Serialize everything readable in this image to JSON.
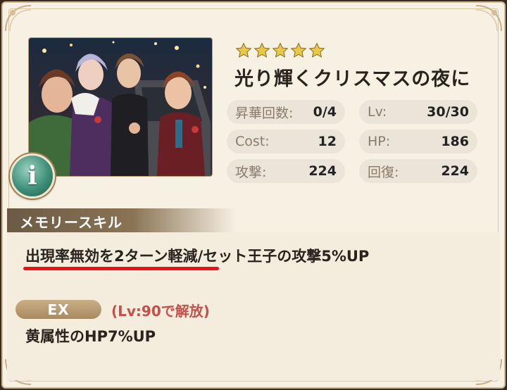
{
  "card": {
    "rarity_stars": 5,
    "title": "光り輝くクリスマスの夜に",
    "star_color": "#e9c74a"
  },
  "info_button": {
    "label": "i"
  },
  "stats": {
    "awakening": {
      "label": "昇華回数:",
      "value": "0/4"
    },
    "level": {
      "label": "Lv:",
      "value": "30/30"
    },
    "cost": {
      "label": "Cost:",
      "value": "12"
    },
    "hp": {
      "label": "HP:",
      "value": "186"
    },
    "attack": {
      "label": "攻撃:",
      "value": "224"
    },
    "recovery": {
      "label": "回復:",
      "value": "224"
    }
  },
  "memory_skill": {
    "header": "メモリースキル",
    "description": "出現率無効を2ターン軽減/セット王子の攻撃5%UP",
    "highlight_color": "#ee1111"
  },
  "ex_skill": {
    "badge": "EX",
    "unlock_condition": "(Lv:90で解放)",
    "description": "黄属性のHP7%UP"
  }
}
